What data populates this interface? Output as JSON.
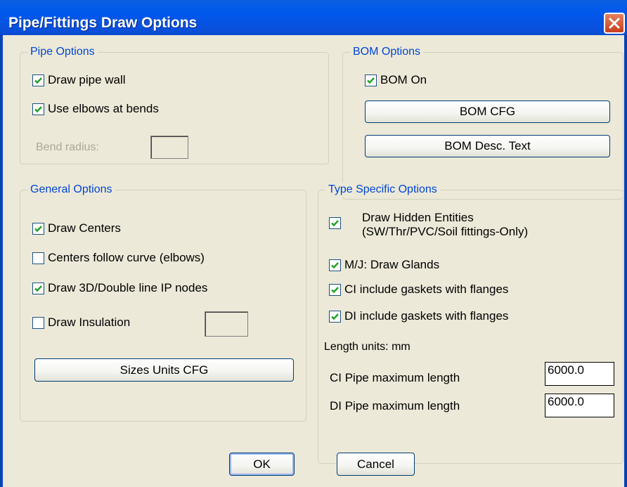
{
  "window": {
    "title": "Pipe/Fittings Draw Options"
  },
  "pipe_options": {
    "title": "Pipe Options",
    "draw_pipe_wall": {
      "label": "Draw pipe wall",
      "checked": true
    },
    "use_elbows": {
      "label": "Use elbows at bends",
      "checked": true
    },
    "bend_radius_label": "Bend radius:",
    "bend_radius_value": ""
  },
  "bom_options": {
    "title": "BOM Options",
    "bom_on": {
      "label": "BOM On",
      "checked": true
    },
    "bom_cfg_label": "BOM CFG",
    "bom_desc_label": "BOM Desc. Text"
  },
  "general_options": {
    "title": "General Options",
    "draw_centers": {
      "label": "Draw Centers",
      "checked": true
    },
    "centers_follow": {
      "label": "Centers follow curve (elbows)",
      "checked": false
    },
    "draw_3d": {
      "label": "Draw 3D/Double line IP nodes",
      "checked": true
    },
    "draw_insulation": {
      "label": "Draw Insulation",
      "checked": false
    },
    "insulation_value": "",
    "sizes_units_label": "Sizes Units CFG"
  },
  "type_specific": {
    "title": "Type Specific Options",
    "hidden_entities": {
      "label_line1": "Draw Hidden Entities",
      "label_line2": "(SW/Thr/PVC/Soil fittings-Only)",
      "checked": true
    },
    "mj_glands": {
      "label": "M/J: Draw Glands",
      "checked": true
    },
    "ci_gaskets": {
      "label": "CI include gaskets with flanges",
      "checked": true
    },
    "di_gaskets": {
      "label": "DI include gaskets with flanges",
      "checked": true
    },
    "length_units": "Length units: mm",
    "ci_max_label": "CI Pipe maximum length",
    "ci_max_value": "6000.0",
    "di_max_label": "DI Pipe maximum length",
    "di_max_value": "6000.0"
  },
  "buttons": {
    "ok": "OK",
    "cancel": "Cancel"
  },
  "colors": {
    "title_bar": "#0058EE",
    "group_title": "#0046D5",
    "dialog_bg": "#ECE9D8",
    "close_button": "#D55A36"
  }
}
